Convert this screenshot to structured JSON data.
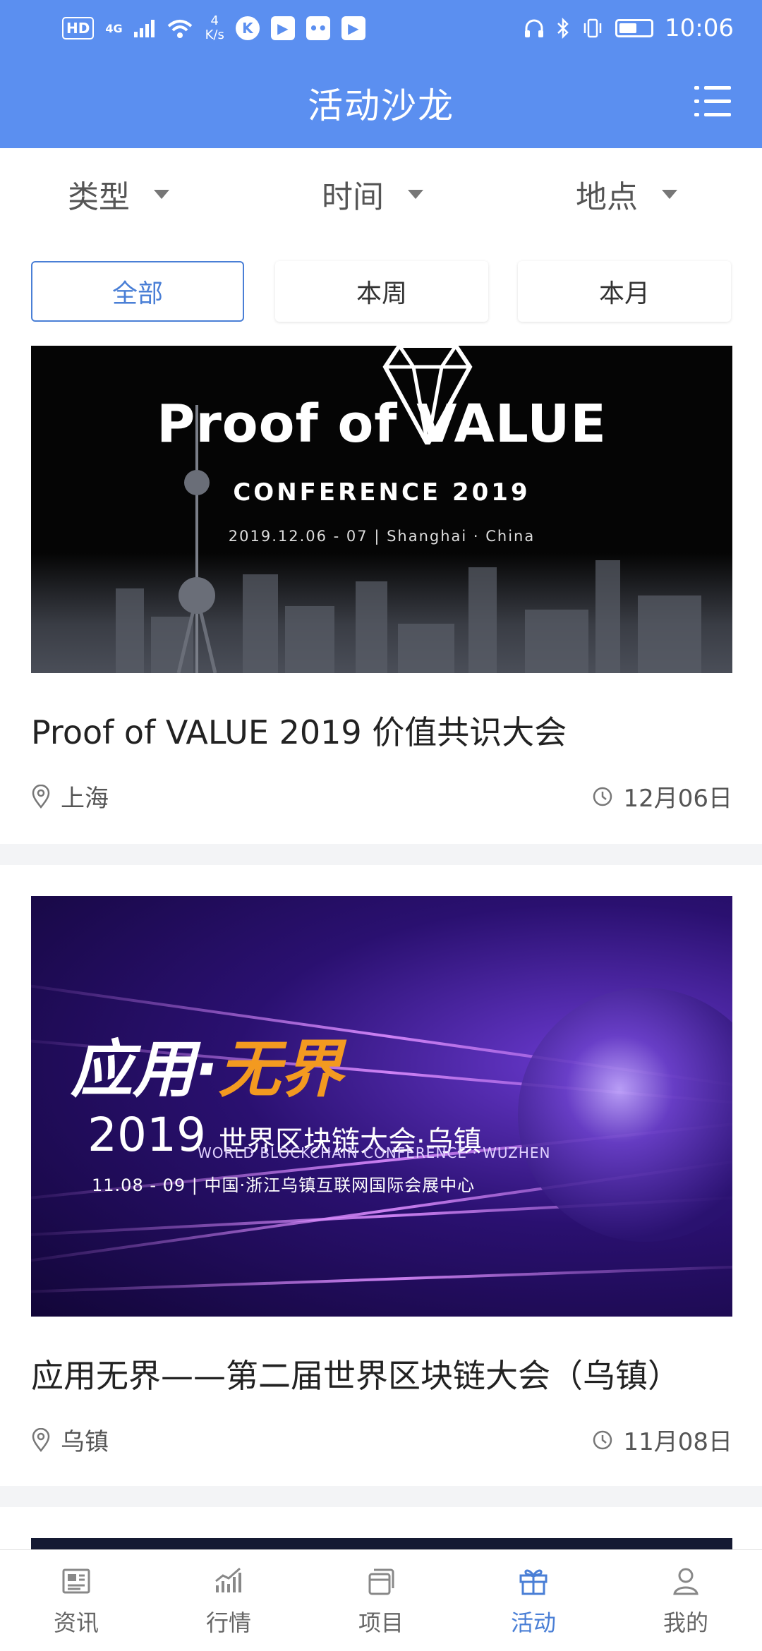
{
  "status_bar": {
    "hd_label": "HD",
    "network_label": "4G",
    "speed_value": "4",
    "speed_unit": "K/s",
    "time": "10:06"
  },
  "header": {
    "title": "活动沙龙",
    "menu_icon": "list-menu-icon"
  },
  "filters": {
    "dropdowns": [
      {
        "label": "类型"
      },
      {
        "label": "时间"
      },
      {
        "label": "地点"
      }
    ],
    "segments": [
      {
        "label": "全部",
        "selected": true
      },
      {
        "label": "本周",
        "selected": false
      },
      {
        "label": "本月",
        "selected": false
      }
    ]
  },
  "events": [
    {
      "title": "Proof of VALUE 2019 价值共识大会",
      "location": "上海",
      "date": "12月06日",
      "banner": {
        "title": "Proof of VALUE",
        "subtitle": "CONFERENCE 2019",
        "info": "2019.12.06 - 07 | Shanghai · China"
      }
    },
    {
      "title": "应用无界——第二届世界区块链大会（乌镇）",
      "location": "乌镇",
      "date": "11月08日",
      "banner": {
        "title_white": "应用·",
        "title_orange": "无界",
        "year": "2019",
        "title_cn": "世界区块链大会·乌镇",
        "title_en": "WORLD BLOCKCHAIN CONFERENCE · WUZHEN",
        "info": "11.08 - 09 | 中国·浙江乌镇互联网国际会展中心"
      }
    }
  ],
  "bottom_nav": [
    {
      "label": "资讯",
      "icon": "newspaper-icon",
      "active": false
    },
    {
      "label": "行情",
      "icon": "chart-icon",
      "active": false
    },
    {
      "label": "项目",
      "icon": "cards-icon",
      "active": false
    },
    {
      "label": "活动",
      "icon": "gift-icon",
      "active": true
    },
    {
      "label": "我的",
      "icon": "profile-icon",
      "active": false
    }
  ],
  "colors": {
    "header_bg": "#5b8ff0",
    "accent": "#4a7fd6",
    "highlight_orange": "#f39a20"
  }
}
